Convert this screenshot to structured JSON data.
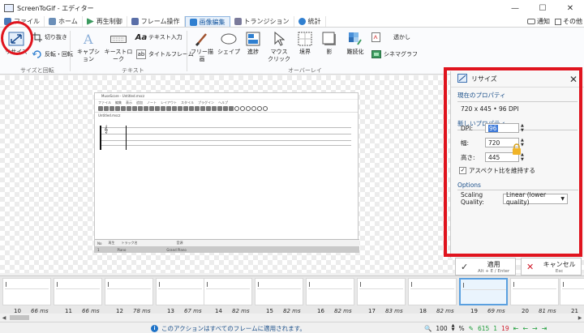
{
  "window": {
    "title": "ScreenToGif - エディター",
    "controls": [
      "—",
      "☐",
      "✕"
    ]
  },
  "tabs": [
    {
      "label": "ファイル",
      "color": "#4a7ab8"
    },
    {
      "label": "ホーム",
      "color": "#6b8fb8"
    },
    {
      "label": "再生制御",
      "color": "#3c9a5f"
    },
    {
      "label": "フレーム操作",
      "color": "#5a6fa8"
    },
    {
      "label": "画像編集",
      "color": "#2f7fd0"
    },
    {
      "label": "トランジション",
      "color": "#7a7a9a"
    },
    {
      "label": "統計",
      "color": "#2f7fd0"
    }
  ],
  "tab_right": {
    "notify": "通知",
    "other": "その他"
  },
  "ribbon": {
    "resize": "リサイズ",
    "crop": "切り抜き",
    "flip_rotate": "反転・回転",
    "group_size": "サイズと回転",
    "caption": "キャプション",
    "keystroke": "キーストローク",
    "text_input": "テキスト入力",
    "title_frame": "タイトルフレーム",
    "group_text": "テキスト",
    "free_draw": "フリー描画",
    "shape": "シェイプ",
    "progress": "進捗",
    "mouse_click": "マウス\nクリック",
    "border": "境界",
    "shadow": "影",
    "obfuscate": "難読化",
    "watermark": "透かし",
    "cinemagraph": "シネマグラフ",
    "group_overlay": "オーバーレイ"
  },
  "preview": {
    "title": "MuseScore - Untitled.mscz",
    "menu": [
      "ファイル",
      "編集",
      "表示",
      "追加",
      "ノート",
      "レイアウト",
      "スタイル",
      "プラグイン",
      "ヘルプ"
    ],
    "score_name": "Untitled.mscz",
    "list_headers": [
      "No",
      "再生",
      "トラック名",
      "",
      "音源"
    ],
    "list_row": [
      "1",
      "",
      "Piano",
      "",
      "Grand Piano"
    ]
  },
  "panel": {
    "title": "リサイズ",
    "current_props": "現在のプロパティ",
    "current_value": "720 x 445 • 96 DPI",
    "new_props": "新しいプロパティ",
    "dpi_label": "DPI:",
    "dpi_value": "96",
    "width_label": "幅:",
    "width_value": "720",
    "height_label": "高さ:",
    "height_value": "445",
    "keep_aspect": "アスペクト比を維持する",
    "options": "Options",
    "scaling_label": "Scaling Quality:",
    "scaling_value": "Linear (lower quality)"
  },
  "actions": {
    "apply": "適用",
    "apply_shortcut": "Alt + E / Enter",
    "cancel": "キャンセル",
    "cancel_shortcut": "Esc"
  },
  "frames": [
    {
      "num": "10",
      "ms": "66 ms"
    },
    {
      "num": "11",
      "ms": "66 ms"
    },
    {
      "num": "12",
      "ms": "78 ms"
    },
    {
      "num": "13",
      "ms": "67 ms"
    },
    {
      "num": "14",
      "ms": "82 ms"
    },
    {
      "num": "15",
      "ms": "82 ms"
    },
    {
      "num": "16",
      "ms": "82 ms"
    },
    {
      "num": "17",
      "ms": "83 ms"
    },
    {
      "num": "18",
      "ms": "82 ms"
    },
    {
      "num": "19",
      "ms": "69 ms"
    },
    {
      "num": "20",
      "ms": "81 ms"
    },
    {
      "num": "21",
      "ms": ""
    }
  ],
  "status": {
    "message": "このアクションはすべてのフレームに適用されます。",
    "zoom": "100",
    "percent": "%",
    "total_frames": "615",
    "selected_count": "1",
    "current_frame": "19"
  }
}
